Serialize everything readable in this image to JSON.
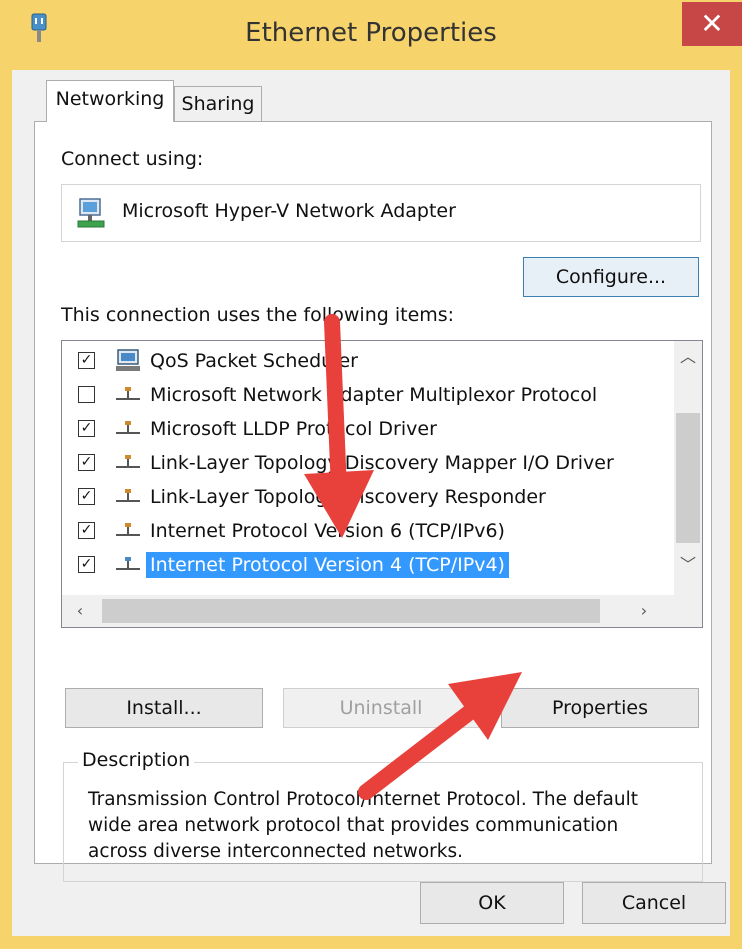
{
  "window": {
    "title": "Ethernet Properties",
    "close_label": "✕"
  },
  "tabs": [
    {
      "label": "Networking",
      "active": true
    },
    {
      "label": "Sharing",
      "active": false
    }
  ],
  "networking": {
    "connect_using_label": "Connect using:",
    "adapter_name": "Microsoft Hyper-V Network Adapter",
    "configure_label": "Configure...",
    "items_label": "This connection uses the following items:",
    "items": [
      {
        "label": "QoS Packet Scheduler",
        "checked": true,
        "icon": "network-service-icon"
      },
      {
        "label": "Microsoft Network Adapter Multiplexor Protocol",
        "checked": false,
        "icon": "protocol-icon"
      },
      {
        "label": "Microsoft LLDP Protocol Driver",
        "checked": true,
        "icon": "protocol-icon"
      },
      {
        "label": "Link-Layer Topology Discovery Mapper I/O Driver",
        "checked": true,
        "icon": "protocol-icon"
      },
      {
        "label": "Link-Layer Topology Discovery Responder",
        "checked": true,
        "icon": "protocol-icon"
      },
      {
        "label": "Internet Protocol Version 6 (TCP/IPv6)",
        "checked": true,
        "icon": "protocol-icon"
      },
      {
        "label": "Internet Protocol Version 4 (TCP/IPv4)",
        "checked": true,
        "icon": "protocol-icon",
        "selected": true
      }
    ],
    "install_label": "Install...",
    "uninstall_label": "Uninstall",
    "properties_label": "Properties",
    "description_title": "Description",
    "description_text": "Transmission Control Protocol/Internet Protocol. The default wide area network protocol that provides communication across diverse interconnected networks."
  },
  "footer": {
    "ok_label": "OK",
    "cancel_label": "Cancel"
  },
  "colors": {
    "frame": "#f7d36c",
    "close": "#c74747",
    "selection": "#3399ff",
    "annotation_arrow": "#e8413c"
  }
}
